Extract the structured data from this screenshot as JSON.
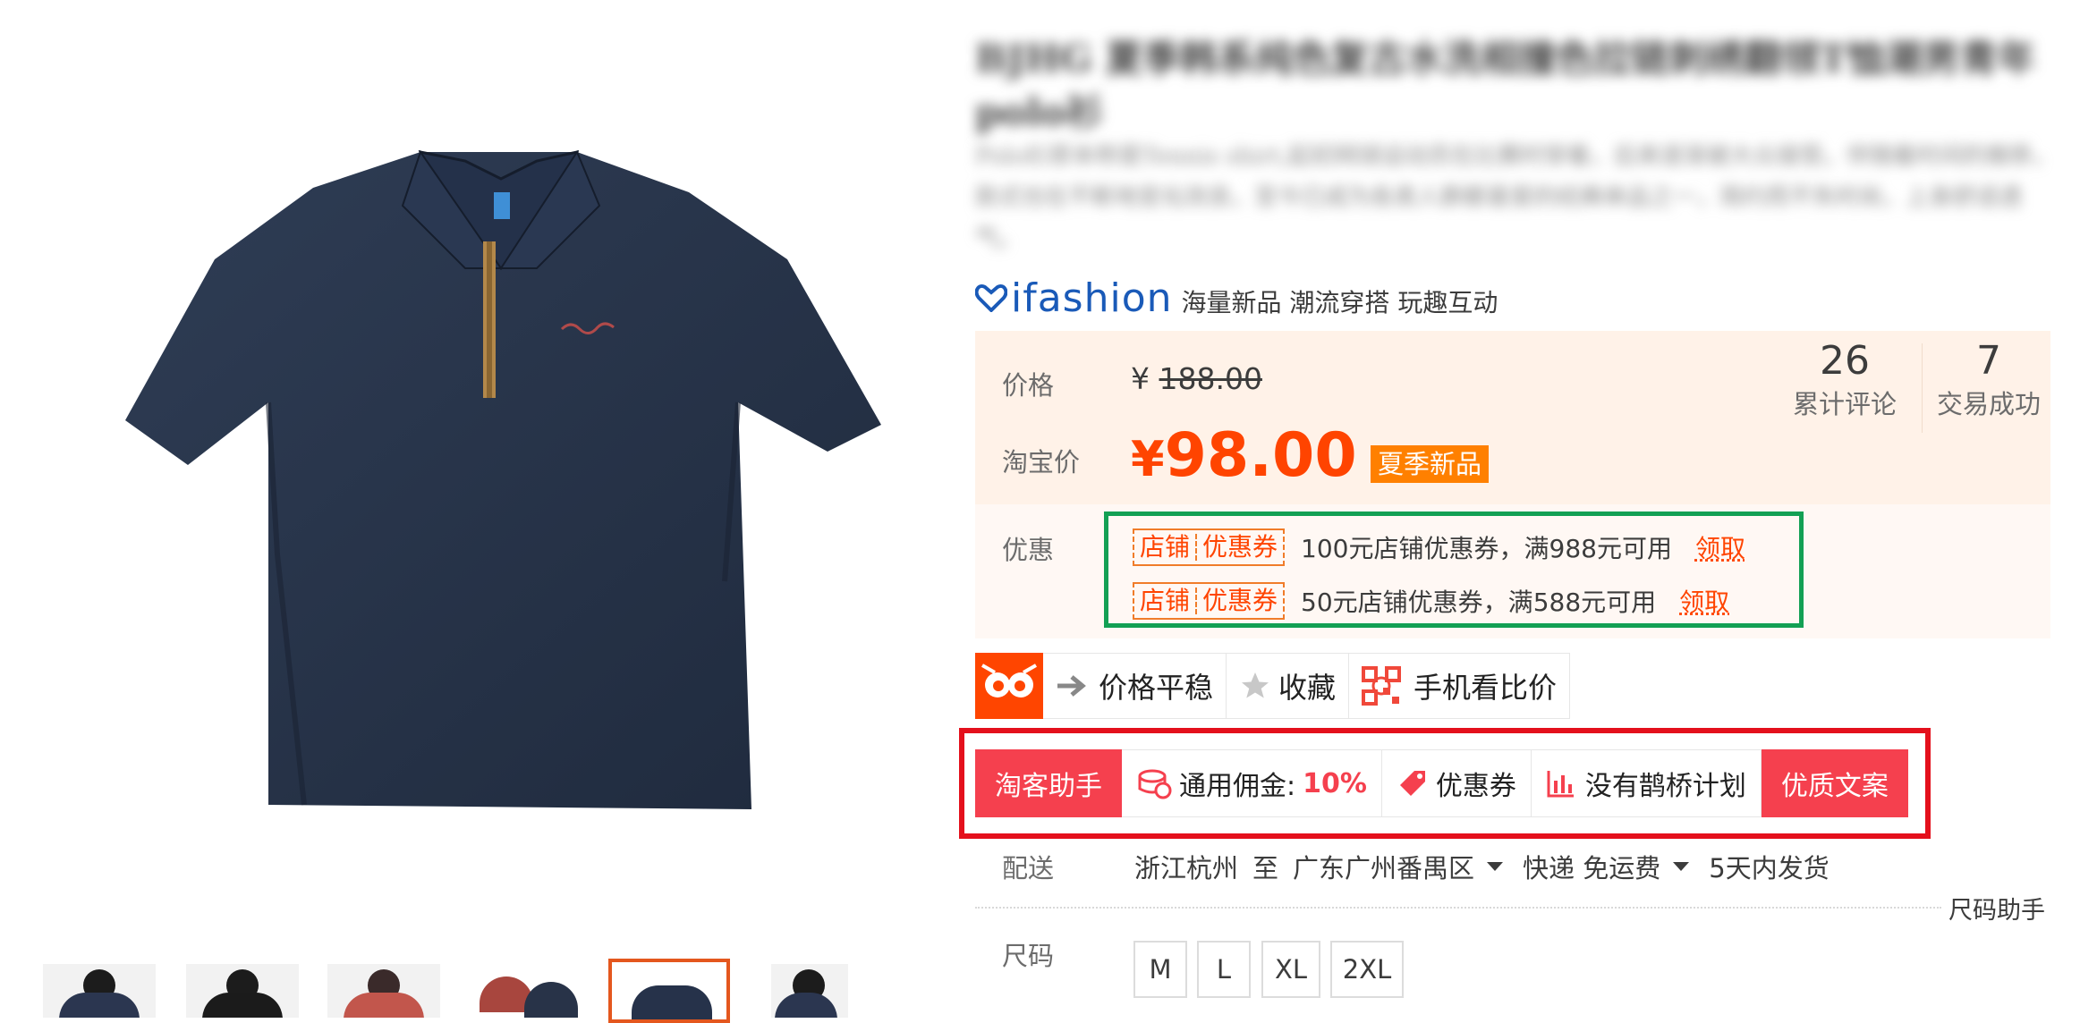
{
  "product": {
    "title": "BJHG 夏季韩系纯色复古水洗相撞色拉链刺绣翻领T恤潮男青年polo衫",
    "description": "Polo衫原本称是Tennis shirt,起初网球运动员在比赛时穿着，后来逐渐被大众接受。伴随着时间的推移，款式也在不断地变化改良，至今已成为各类人群都喜爱的经典单品之一，简约而不失时尚，上身舒适透气。",
    "ifashion_logo": "ifashion",
    "ifashion_slogan": "海量新品 潮流穿搭 玩趣互动",
    "thumbnails": [
      "thumb-1",
      "thumb-2",
      "thumb-3",
      "thumb-4",
      "thumb-5",
      "thumb-6"
    ],
    "active_thumbnail": 5,
    "colors": {
      "accent": "#ff4400",
      "coupon_frame": "#13a054",
      "taoke_frame": "#e4101c",
      "taoke_red": "#f5404e",
      "season_tag": "#ff8000"
    }
  },
  "price": {
    "label": "价格",
    "currency": "¥",
    "original": "188.00",
    "taobao_label": "淘宝价",
    "taobao_price": "98.00",
    "tag": "夏季新品",
    "reviews_count": "26",
    "reviews_label": "累计评论",
    "deals_count": "7",
    "deals_label": "交易成功"
  },
  "promo": {
    "label": "优惠",
    "coupons": [
      {
        "tag_a": "店铺",
        "tag_b": "优惠券",
        "amount": "100",
        "text_a": "元店铺优惠券，满",
        "threshold": "988",
        "text_b": "元可用",
        "claim": "领取"
      },
      {
        "tag_a": "店铺",
        "tag_b": "优惠券",
        "amount": "50",
        "text_a": "元店铺优惠券，满",
        "threshold": "588",
        "text_b": "元可用",
        "claim": "领取"
      }
    ]
  },
  "tools": {
    "owl_icon": "owl-icon",
    "price_stable": "价格平稳",
    "favorite": "收藏",
    "mobile_compare": "手机看比价"
  },
  "taoke": {
    "assistant": "淘客助手",
    "commission_label": "通用佣金:",
    "commission_value": "10%",
    "coupon": "优惠券",
    "magpie": "没有鹊桥计划",
    "quality_copy": "优质文案"
  },
  "shipping": {
    "label": "配送",
    "from": "浙江杭州",
    "to_word": "至",
    "to": "广东广州番禺区",
    "method": "快递 免运费",
    "days_num": "5",
    "days_text": "天内发货"
  },
  "size": {
    "helper": "尺码助手",
    "label": "尺码",
    "options": [
      "M",
      "L",
      "XL",
      "2XL"
    ]
  }
}
